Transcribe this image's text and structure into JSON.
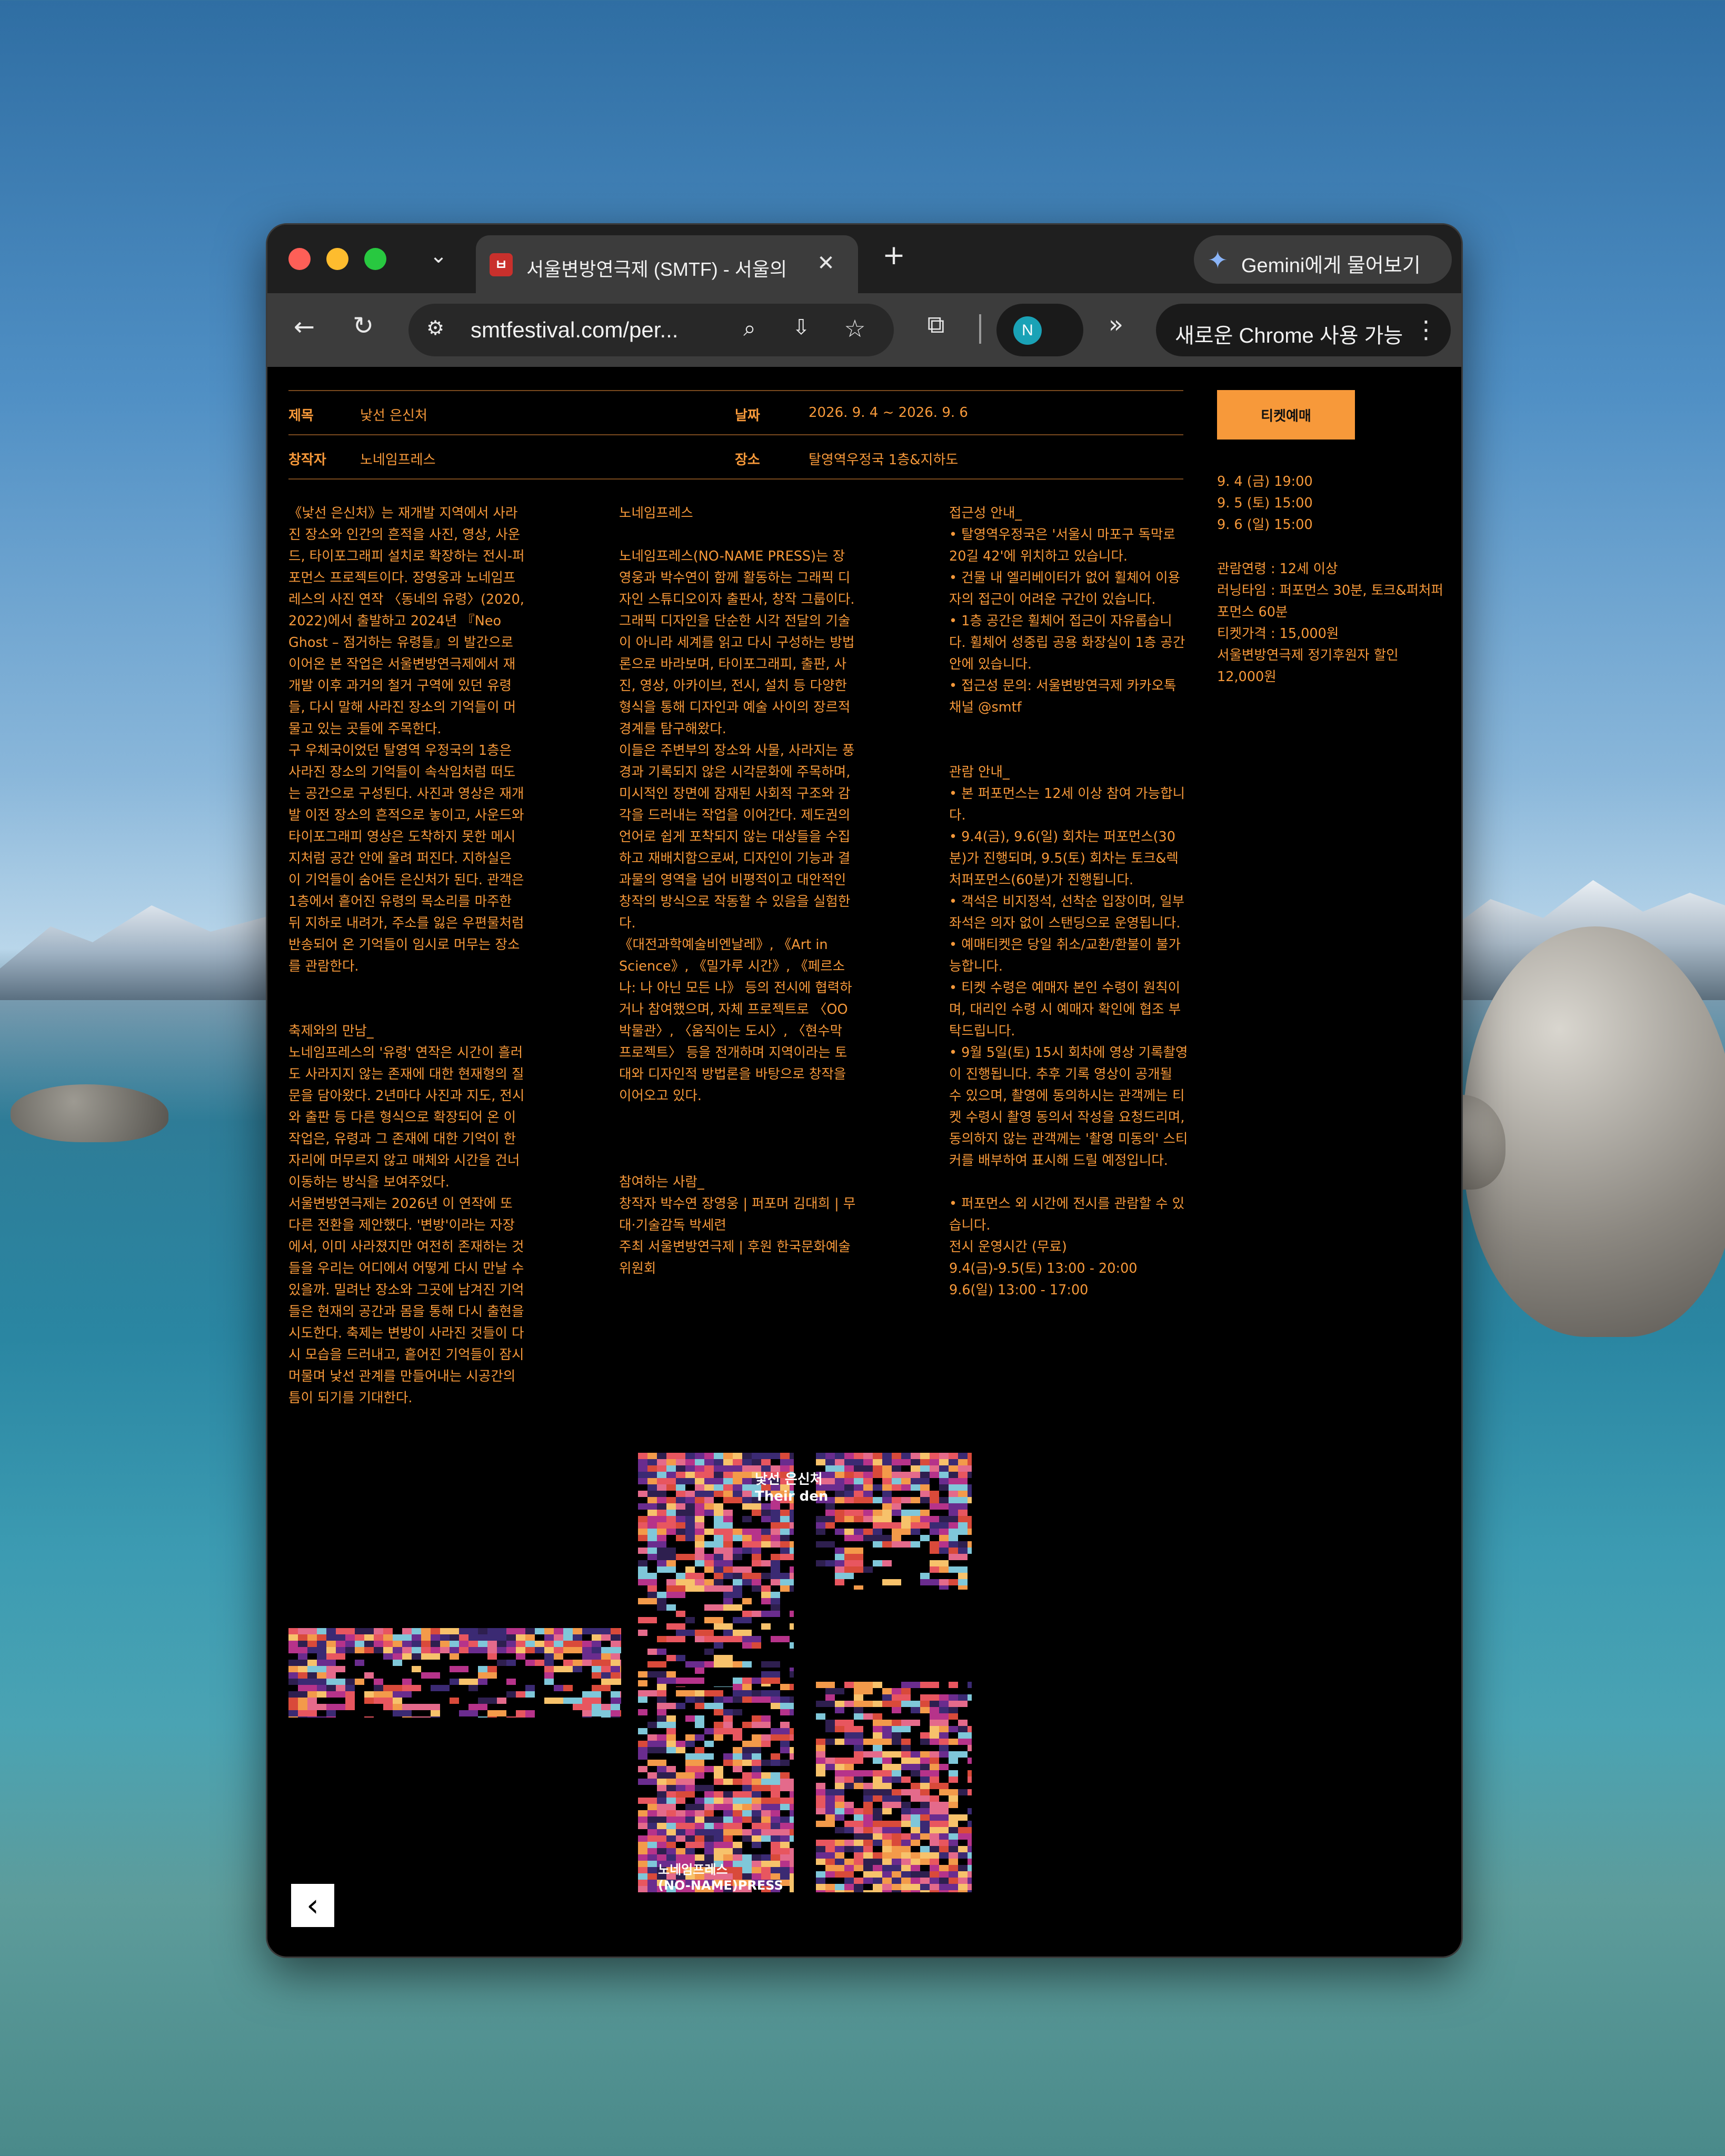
{
  "browser": {
    "tab_title": "서울변방연극제 (SMTF) - 서울의",
    "url": "smtfestival.com/per...",
    "gemini_label": "Gemini에게 물어보기",
    "profile_initial": "N",
    "update_label": "새로운 Chrome 사용 가능"
  },
  "info": {
    "title_label": "제목",
    "title_value": "낯선 은신처",
    "date_label": "날짜",
    "date_value": "2026. 9. 4 ~ 2026. 9. 6",
    "creator_label": "창작자",
    "creator_value": "노네임프레스",
    "venue_label": "장소",
    "venue_value": "탈영역우정국 1층&지하도"
  },
  "ticket": {
    "button_label": "티켓예매",
    "schedule": "9. 4 (금) 19:00\n9. 5 (토) 15:00\n9. 6 (일) 15:00",
    "details": "관람연령 : 12세 이상\n러닝타임 : 퍼포먼스 30분, 토크&퍼처퍼포먼스 60분\n티켓가격 : 15,000원\n서울변방연극제 정기후원자 할인 12,000원"
  },
  "columns": {
    "col1": "《낯선 은신처》는 재개발 지역에서 사라진 장소와 인간의 흔적을 사진, 영상, 사운드, 타이포그래피 설치로 확장하는 전시-퍼포먼스 프로젝트이다. 장영웅과 노네임프레스의 사진 연작 〈동네의 유령〉(2020, 2022)에서 출발하고 2024년 『Neo Ghost – 점거하는 유령들』의 발간으로 이어온 본 작업은 서울변방연극제에서 재개발 이후 과거의 철거 구역에 있던 유령들, 다시 말해 사라진 장소의 기억들이 머물고 있는 곳들에 주목한다.\n구 우체국이었던 탈영역 우정국의 1층은 사라진 장소의 기억들이 속삭임처럼 떠도는 공간으로 구성된다. 사진과 영상은 재개발 이전 장소의 흔적으로 놓이고, 사운드와 타이포그래피 영상은 도착하지 못한 메시지처럼 공간 안에 울려 퍼진다. 지하실은 이 기억들이 숨어든 은신처가 된다. 관객은 1층에서 흩어진 유령의 목소리를 마주한 뒤 지하로 내려가, 주소를 잃은 우편물처럼 반송되어 온 기억들이 임시로 머무는 장소를 관람한다.\n\n\n축제와의 만남_\n노네임프레스의 '유령' 연작은 시간이 흘러도 사라지지 않는 존재에 대한 현재형의 질문을 담아왔다. 2년마다 사진과 지도, 전시와 출판 등 다른 형식으로 확장되어 온 이 작업은, 유령과 그 존재에 대한 기억이 한 자리에 머무르지 않고 매체와 시간을 건너 이동하는 방식을 보여주었다.\n서울변방연극제는 2026년 이 연작에 또 다른 전환을 제안했다. '변방'이라는 자장에서, 이미 사라졌지만 여전히 존재하는 것들을 우리는 어디에서 어떻게 다시 만날 수 있을까. 밀려난 장소와 그곳에 남겨진 기억들은 현재의 공간과 몸을 통해 다시 출현을 시도한다. 축제는 변방이 사라진 것들이 다시 모습을 드러내고, 흩어진 기억들이 잠시 머물며 낯선 관계를 만들어내는 시공간의 틈이 되기를 기대한다.",
    "col2": "노네임프레스\n\n노네임프레스(NO-NAME PRESS)는 장영웅과 박수연이 함께 활동하는 그래픽 디자인 스튜디오이자 출판사, 창작 그룹이다. 그래픽 디자인을 단순한 시각 전달의 기술이 아니라 세계를 읽고 다시 구성하는 방법론으로 바라보며, 타이포그래피, 출판, 사진, 영상, 아카이브, 전시, 설치 등 다양한 형식을 통해 디자인과 예술 사이의 장르적 경계를 탐구해왔다.\n이들은 주변부의 장소와 사물, 사라지는 풍경과 기록되지 않은 시각문화에 주목하며, 미시적인 장면에 잠재된 사회적 구조와 감각을 드러내는 작업을 이어간다. 제도권의 언어로 쉽게 포착되지 않는 대상들을 수집하고 재배치함으로써, 디자인이 기능과 결과물의 영역을 넘어 비평적이고 대안적인 창작의 방식으로 작동할 수 있음을 실험한다.\n《대전과학예술비엔날레》, 《Art in Science》, 《밀가루 시간》, 《페르소나: 나 아닌 모든 나》 등의 전시에 협력하거나 참여했으며, 자체 프로젝트로 〈OO박물관〉, 〈움직이는 도시〉, 〈현수막 프로젝트〉 등을 전개하며 지역이라는 토대와 디자인적 방법론을 바탕으로 창작을 이어오고 있다.\n\n\n\n참여하는 사람_\n창작자 박수연 장영웅 | 퍼포머 김대희 | 무대·기술감독 박세련\n주최 서울변방연극제 | 후원 한국문화예술위원회",
    "col3": "접근성 안내_\n• 탈영역우정국은 '서울시 마포구 독막로 20길 42'에 위치하고 있습니다.\n• 건물 내 엘리베이터가 없어 휠체어 이용자의 접근이 어려운 구간이 있습니다.\n• 1층 공간은 휠체어 접근이 자유롭습니다. 휠체어 성중립 공용 화장실이 1층 공간 안에 있습니다.\n• 접근성 문의: 서울변방연극제 카카오톡 채널 @smtf\n\n\n관람 안내_\n• 본 퍼포먼스는 12세 이상 참여 가능합니다.\n• 9.4(금), 9.6(일) 회차는 퍼포먼스(30분)가 진행되며, 9.5(토) 회차는 토크&렉처퍼포먼스(60분)가 진행됩니다.\n• 객석은 비지정석, 선착순 입장이며, 일부 좌석은 의자 없이 스탠딩으로 운영됩니다.\n• 예매티켓은 당일 취소/교환/환불이 불가능합니다.\n• 티켓 수령은 예매자 본인 수령이 원칙이며, 대리인 수령 시 예매자 확인에 협조 부탁드립니다.\n• 9월 5일(토) 15시 회차에 영상 기록촬영이 진행됩니다. 추후 기록 영상이 공개될 수 있으며, 촬영에 동의하시는 관객께는 티켓 수령시 촬영 동의서 작성을 요청드리며, 동의하지 않는 관객께는 '촬영 미동의' 스티커를 배부하여 표시해 드릴 예정입니다.\n\n• 퍼포먼스 외 시간에 전시를 관람할 수 있습니다.\n전시 운영시간 (무료)\n9.4(금)-9.5(토) 13:00 - 20:00\n9.6(일) 13:00 - 17:00"
  },
  "poster": {
    "title_ko": "낯선 은신처",
    "title_en": "Their den",
    "credit_ko": "노네임프레스",
    "credit_en": "(NO-NAME)PRESS"
  },
  "colors": {
    "accent": "#f7993a",
    "page_bg": "#000000"
  }
}
